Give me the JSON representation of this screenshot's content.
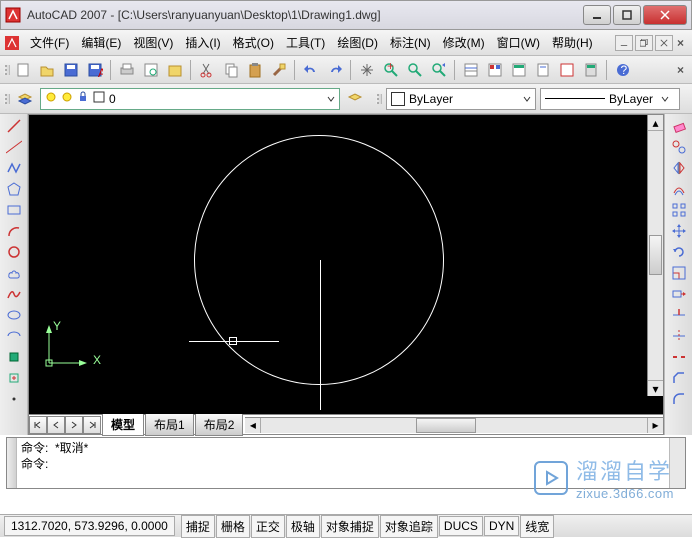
{
  "window": {
    "app_name": "AutoCAD 2007",
    "doc_path": "[C:\\Users\\ranyuanyuan\\Desktop\\1\\Drawing1.dwg]"
  },
  "menus": [
    {
      "label": "文件(F)"
    },
    {
      "label": "编辑(E)"
    },
    {
      "label": "视图(V)"
    },
    {
      "label": "插入(I)"
    },
    {
      "label": "格式(O)"
    },
    {
      "label": "工具(T)"
    },
    {
      "label": "绘图(D)"
    },
    {
      "label": "标注(N)"
    },
    {
      "label": "修改(M)"
    },
    {
      "label": "窗口(W)"
    },
    {
      "label": "帮助(H)"
    }
  ],
  "layer": {
    "current": "0",
    "color_swatch": "#ffffff"
  },
  "properties": {
    "color_label": "ByLayer",
    "linetype_label": "ByLayer"
  },
  "tabs": {
    "model": "模型",
    "layout1": "布局1",
    "layout2": "布局2"
  },
  "command": {
    "line1": "命令:  *取消*",
    "line2": "命令:"
  },
  "status": {
    "coords": "1312.7020, 573.9296, 0.0000",
    "toggles": [
      "捕捉",
      "栅格",
      "正交",
      "极轴",
      "对象捕捉",
      "对象追踪",
      "DUCS",
      "DYN",
      "线宽"
    ]
  },
  "ucs": {
    "x": "X",
    "y": "Y"
  },
  "watermark": {
    "brand": "溜溜自学",
    "url": "zixue.3d66.com"
  },
  "icons": {
    "new": "new-icon",
    "open": "open-icon",
    "save": "save-icon",
    "saveas": "saveas-icon",
    "plot": "plot-icon",
    "preview": "preview-icon",
    "publish": "publish-icon",
    "cut": "cut-icon",
    "copy": "copy-icon",
    "paste": "paste-icon",
    "matchprop": "matchprop-icon",
    "undo": "undo-icon",
    "redo": "redo-icon",
    "pan": "pan-icon",
    "zoomrt": "zoomrt-icon",
    "zoomwin": "zoomwin-icon",
    "zoomprev": "zoomprev-icon",
    "props": "props-icon",
    "dc": "dc-icon",
    "tp": "tp-icon",
    "ssm": "ssm-icon",
    "markup": "markup-icon",
    "qcalc": "qcalc-icon",
    "help": "help-icon"
  },
  "drawtools": [
    {
      "name": "line-icon"
    },
    {
      "name": "xline-icon"
    },
    {
      "name": "polyline-icon"
    },
    {
      "name": "polygon-icon"
    },
    {
      "name": "rectangle-icon"
    },
    {
      "name": "arc-icon"
    },
    {
      "name": "circle-icon"
    },
    {
      "name": "revcloud-icon"
    },
    {
      "name": "spline-icon"
    },
    {
      "name": "ellipse-icon"
    },
    {
      "name": "ellipsearc-icon"
    },
    {
      "name": "insert-icon"
    },
    {
      "name": "makeblock-icon"
    },
    {
      "name": "point-icon"
    }
  ],
  "modtools": [
    {
      "name": "erase-icon"
    },
    {
      "name": "copy-obj-icon"
    },
    {
      "name": "mirror-icon"
    },
    {
      "name": "offset-icon"
    },
    {
      "name": "array-icon"
    },
    {
      "name": "move-icon"
    },
    {
      "name": "rotate-icon"
    },
    {
      "name": "scale-icon"
    },
    {
      "name": "stretch-icon"
    },
    {
      "name": "trim-icon"
    },
    {
      "name": "extend-icon"
    },
    {
      "name": "break-icon"
    },
    {
      "name": "chamfer-icon"
    },
    {
      "name": "fillet-icon"
    }
  ]
}
